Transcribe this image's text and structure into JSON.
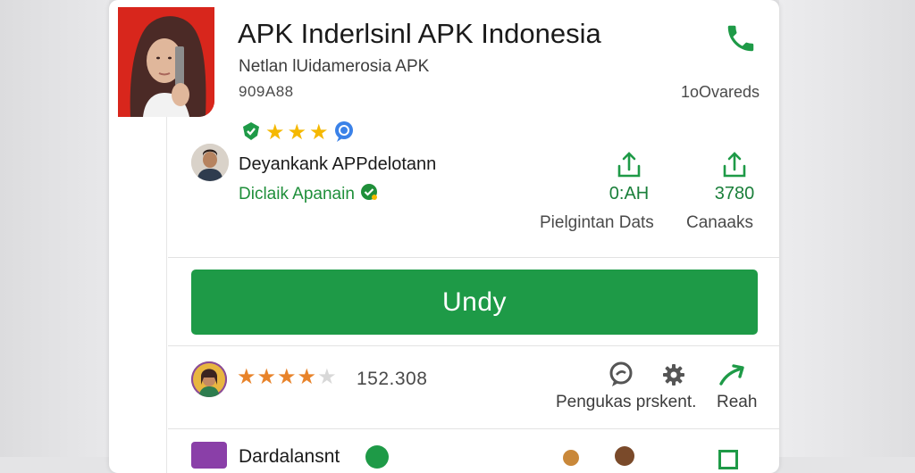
{
  "app": {
    "title": "APK Inderlsinl APK Indonesia",
    "subtitle": "Netlan lUidamerosia APK",
    "code": "909A88",
    "downloads": "1oOvareds"
  },
  "developer": {
    "name": "Deyankank APPdelotann",
    "status": "Diclaik Apanain"
  },
  "stats": [
    {
      "value": "0:AH",
      "label": "Pielgintan Dats",
      "icon": "share-up-icon"
    },
    {
      "value": "3780",
      "label": "Canaaks",
      "icon": "share-up-icon"
    }
  ],
  "install_button": {
    "label": "Undy"
  },
  "rating": {
    "stars": 4,
    "count": "152.308"
  },
  "actions": {
    "primary_label": "Pengukas prskent.",
    "secondary_label": "Reah"
  },
  "next_row": {
    "label": "Dardalansnt"
  },
  "colors": {
    "accent_green": "#1e9a47",
    "star_gold": "#f5b800",
    "star_orange": "#e8832a",
    "hero_red": "#d8261c",
    "verified_green": "#1f8f3a"
  }
}
